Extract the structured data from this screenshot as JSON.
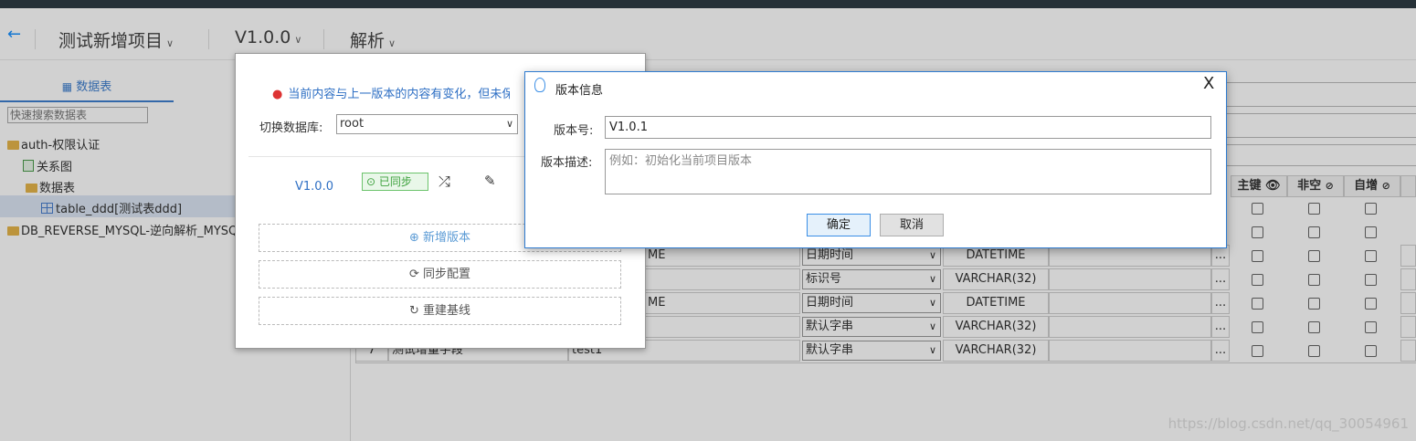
{
  "header": {
    "back_icon": "arrow-left-icon",
    "project": "测试新增项目",
    "version": "V1.0.0",
    "action": "解析"
  },
  "sidebar": {
    "tab_label": "数据表",
    "search_placeholder": "快速搜索数据表",
    "tree": [
      {
        "label": "auth-权限认证"
      },
      {
        "label": "关系图"
      },
      {
        "label": "数据表"
      },
      {
        "label": "table_ddd[测试表ddd]"
      },
      {
        "label": "DB_REVERSE_MYSQL-逆向解析_MYSQL"
      }
    ]
  },
  "version_panel": {
    "notice": "当前内容与上一版本的内容有变化，但未保",
    "db_label": "切换数据库:",
    "db_value": "root",
    "version_label": "V1.0.0",
    "status": "已同步",
    "buttons": {
      "new_version": "新增版本",
      "sync_config": "同步配置",
      "rebuild_baseline": "重建基线"
    }
  },
  "dialog": {
    "title": "版本信息",
    "close": "X",
    "version_no_label": "版本号:",
    "version_no_value": "V1.0.1",
    "desc_label": "版本描述:",
    "desc_placeholder": "例如：初始化当前项目版本",
    "ok": "确定",
    "cancel": "取消"
  },
  "table": {
    "headers": [
      "主键",
      "非空",
      "自增"
    ],
    "rows": [
      {
        "partial_code": "ME",
        "domain": "日期时间",
        "type": "DATETIME"
      },
      {
        "partial_code": "",
        "domain": "标识号",
        "type": "VARCHAR(32)"
      },
      {
        "partial_code": "ME",
        "domain": "日期时间",
        "type": "DATETIME"
      },
      {
        "partial_code": "",
        "domain": "默认字串",
        "type": "VARCHAR(32)"
      },
      {
        "index": "7",
        "name": "测试增量字段",
        "code": "test1",
        "domain": "默认字串",
        "type": "VARCHAR(32)"
      }
    ],
    "more_btn": "..."
  },
  "watermark": "https://blog.csdn.net/qq_30054961"
}
